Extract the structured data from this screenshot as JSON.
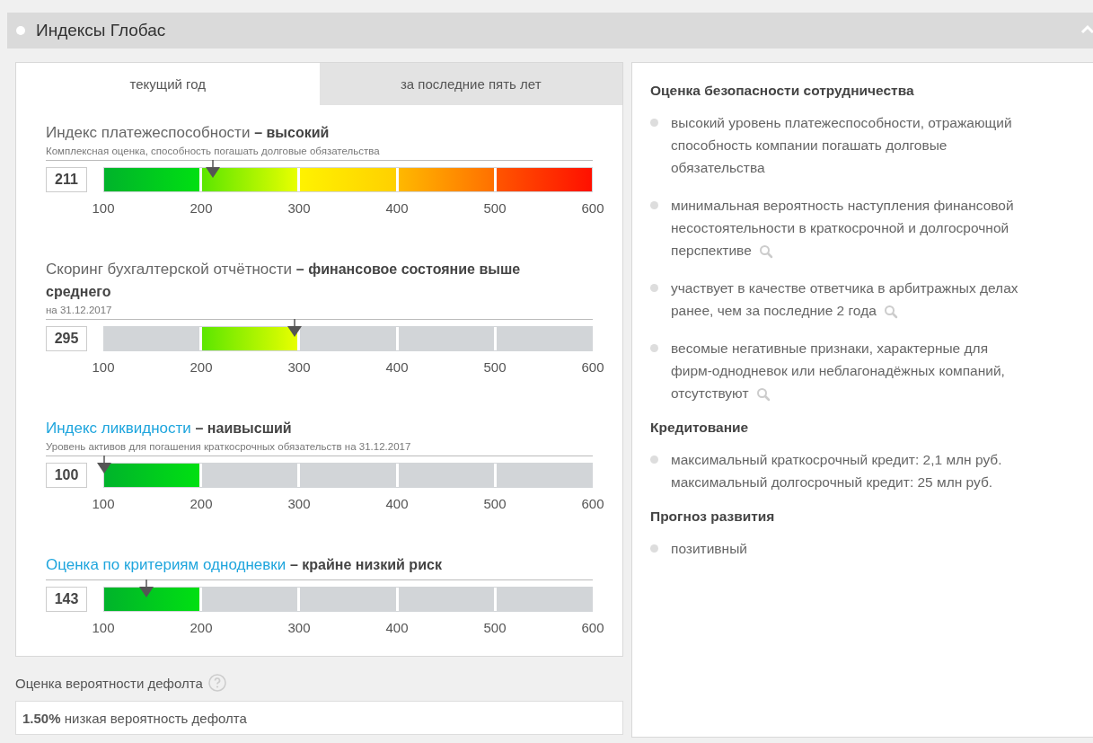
{
  "header": {
    "title": "Индексы Глобас",
    "expanded": true
  },
  "tabs": [
    {
      "label": "текущий год",
      "selected": true
    },
    {
      "label": "за последние пять лет",
      "selected": false
    }
  ],
  "gauges": [
    {
      "label": "Индекс платежеспособности",
      "link": false,
      "rating": "– высокий",
      "subtitle": "Комплексная оценка, способность погашать долговые обязательства",
      "value": "211",
      "level": 0.222,
      "segments": [
        {
          "active": true
        },
        {
          "active": true
        },
        {
          "active": true
        },
        {
          "active": true
        },
        {
          "active": true
        }
      ],
      "ticks": [
        "100",
        "200",
        "300",
        "400",
        "500",
        "600"
      ]
    },
    {
      "label": "Скоринг бухгалтерской отчётности",
      "link": false,
      "rating": "– финансовое состояние выше среднего",
      "subtitle": "на 31.12.2017",
      "value": "295",
      "level": 0.39,
      "segments": [
        {
          "active": false
        },
        {
          "active": true
        },
        {
          "active": false
        },
        {
          "active": false
        },
        {
          "active": false
        }
      ],
      "ticks": [
        "100",
        "200",
        "300",
        "400",
        "500",
        "600"
      ]
    },
    {
      "label": "Индекс ликвидности",
      "link": true,
      "rating": "– наивысший",
      "subtitle": "Уровень активов для погашения краткосрочных обязательств на 31.12.2017",
      "value": "100",
      "level": 0,
      "segments": [
        {
          "active": true
        },
        {
          "active": false
        },
        {
          "active": false
        },
        {
          "active": false
        },
        {
          "active": false
        }
      ],
      "ticks": [
        "100",
        "200",
        "300",
        "400",
        "500",
        "600"
      ]
    },
    {
      "label": "Оценка по критериям однодневки",
      "link": true,
      "rating": "– крайне низкий риск",
      "value": "143",
      "level": 0.086,
      "segments": [
        {
          "active": true
        },
        {
          "active": false
        },
        {
          "active": false
        },
        {
          "active": false
        },
        {
          "active": false
        }
      ],
      "ticks": [
        "100",
        "200",
        "300",
        "400",
        "500",
        "600"
      ]
    }
  ],
  "default": {
    "label": "Оценка вероятности дефолта",
    "value": "**1.50%** низкая вероятность дефолта"
  },
  "sections": [
    {
      "heading": "Оценка безопасности сотрудничества",
      "items": [
        {
          "lines": [
            "высокий уровень платежеспособности, отражающий способность компании погашать долговые обязательства"
          ],
          "search": false
        },
        {
          "lines": [
            "минимальная вероятность наступления финансовой несостоятельности в краткосрочной и долгосрочной перспективе"
          ],
          "search": true
        },
        {
          "lines": [
            "участвует в качестве ответчика в арбитражных делах ранее, чем за последние 2 года"
          ],
          "search": true
        },
        {
          "lines": [
            "весомые негативные признаки, характерные для фирм-однодневок или неблагонадёжных компаний, отсутствуют"
          ],
          "search": true
        }
      ]
    },
    {
      "heading": "Кредитование",
      "items": [
        {
          "lines": [
            "максимальный краткосрочный кредит: 2,1 млн руб.",
            "максимальный долгосрочный кредит: 25 млн руб."
          ],
          "search": false
        }
      ]
    },
    {
      "heading": "Прогноз развития",
      "items": [
        {
          "lines": [
            "позитивный"
          ],
          "search": false
        }
      ]
    }
  ]
}
